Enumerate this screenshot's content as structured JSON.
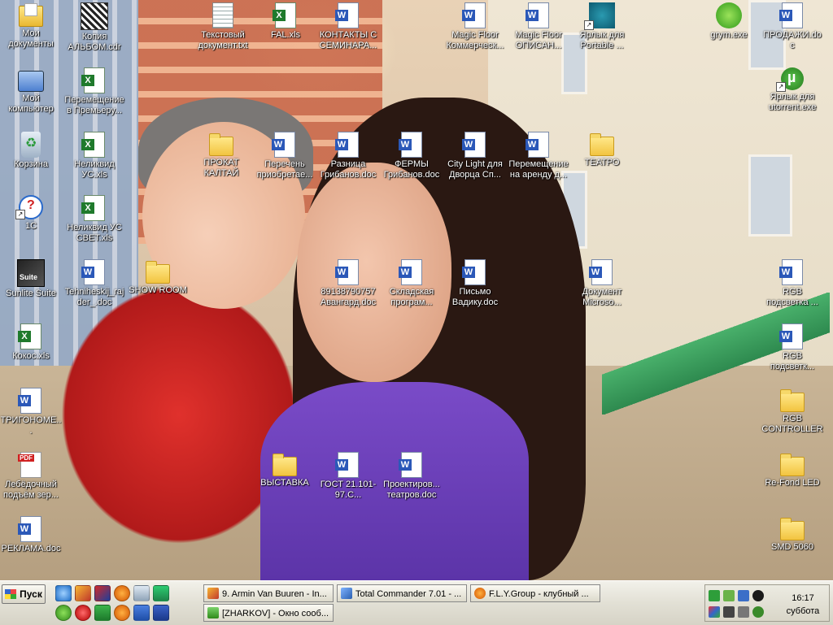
{
  "desktop": {
    "icons": [
      {
        "label": "Мои документы",
        "type": "mydocs"
      },
      {
        "label": "Копия АЛЬБОМ.cdr",
        "type": "cdr"
      },
      {
        "label": "Текстовый документ.txt",
        "type": "txt"
      },
      {
        "label": "FAL.xls",
        "type": "xls"
      },
      {
        "label": "КОНТАКТЫ С СЕМИНАРА...",
        "type": "doc"
      },
      {
        "label": "Magic Floor Коммерческ...",
        "type": "doc"
      },
      {
        "label": "Magic Floor ОПИСАН...",
        "type": "doc"
      },
      {
        "label": "Ярлык для Portable ...",
        "type": "star"
      },
      {
        "label": "grym.exe",
        "type": "grym"
      },
      {
        "label": "ПРОДАЖИ.doc",
        "type": "doc"
      },
      {
        "label": "Мой компьютер",
        "type": "computer"
      },
      {
        "label": "Перемещение в Премьеру...",
        "type": "xls"
      },
      {
        "label": "Ярлык для utorrent.exe",
        "type": "torrent"
      },
      {
        "label": "Корзина",
        "type": "bin"
      },
      {
        "label": "Неликвид УС.xls",
        "type": "xls"
      },
      {
        "label": "ПРОКАТ КАЛТАЙ",
        "type": "folder"
      },
      {
        "label": "Перечень приобретае...",
        "type": "doc"
      },
      {
        "label": "Разница Грибанов.doc",
        "type": "doc"
      },
      {
        "label": "ФЕРМЫ Грибанов.doc",
        "type": "doc"
      },
      {
        "label": "City Light для Дворца Сп...",
        "type": "doc"
      },
      {
        "label": "Перемещение на аренду д...",
        "type": "doc"
      },
      {
        "label": "ТЕАТРО",
        "type": "folder"
      },
      {
        "label": "1С",
        "type": "1c"
      },
      {
        "label": "Неликвид УС СВЕТ.xls",
        "type": "xls"
      },
      {
        "label": "Sunlite Suite",
        "type": "suite"
      },
      {
        "label": "Tehniheskij_rajder_.doc",
        "type": "doc"
      },
      {
        "label": "SHOW ROOM",
        "type": "folder"
      },
      {
        "label": "89138790757 Авангард.doc",
        "type": "doc"
      },
      {
        "label": "Складская програм...",
        "type": "doc"
      },
      {
        "label": "Письмо Вадику.doc",
        "type": "doc"
      },
      {
        "label": "Документ Microso...",
        "type": "doc"
      },
      {
        "label": "RGB подсветка ...",
        "type": "doc"
      },
      {
        "label": "Кокос.xls",
        "type": "xls"
      },
      {
        "label": "RGB подсветк...",
        "type": "doc"
      },
      {
        "label": "ТРИГОНОМЕ...",
        "type": "doc"
      },
      {
        "label": "RGB CONTROLLER",
        "type": "folder"
      },
      {
        "label": "Лебёдочный подъём зер...",
        "type": "pdf"
      },
      {
        "label": "ВЫСТАВКА",
        "type": "folder"
      },
      {
        "label": "ГОСТ 21.101-97.С...",
        "type": "doc"
      },
      {
        "label": "Проектиров... театров.doc",
        "type": "doc"
      },
      {
        "label": "Re-Fond LED",
        "type": "folder"
      },
      {
        "label": "РЕКЛАМА.doc",
        "type": "doc"
      },
      {
        "label": "SMD 5060",
        "type": "folder"
      }
    ]
  },
  "taskbar": {
    "start_label": "Пуск",
    "quicklaunch": [
      "ie-icon",
      "winamp-icon",
      "dice-icon",
      "firefox-icon",
      "recycle-icon",
      "vlc-icon",
      "green-icon",
      "ball-icon",
      "excel-icon",
      "firefox2-icon",
      "word-icon",
      "save-icon"
    ],
    "tasks": [
      {
        "label": "9. Armin Van Buuren - In...",
        "icon": "winamp"
      },
      {
        "label": "Total Commander 7.01 - ...",
        "icon": "totalcmd"
      },
      {
        "label": "F.L.Y.Group - клубный ...",
        "icon": "firefox"
      },
      {
        "label": "[ZHARKOV] - Окно сооб...",
        "icon": "chat"
      }
    ],
    "tray": {
      "time": "16:17",
      "day": "суббота"
    }
  }
}
